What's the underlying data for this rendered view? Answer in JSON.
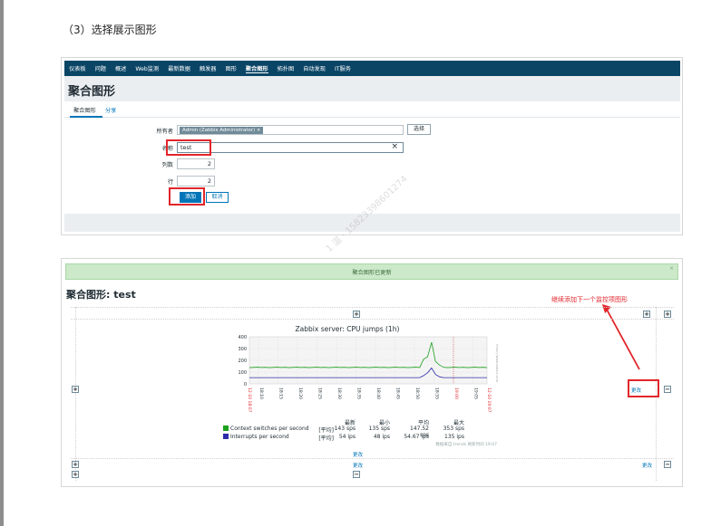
{
  "step_title": "（3）选择展示图形",
  "panel1": {
    "nav": [
      "仪表板",
      "问题",
      "概述",
      "Web监测",
      "最新数据",
      "触发器",
      "图形",
      "聚合图形",
      "拓扑图",
      "自动发现",
      "IT服务"
    ],
    "nav_active": "聚合图形",
    "page_title": "聚合图形",
    "tabs": {
      "main": "聚合图形",
      "share": "分享"
    },
    "form": {
      "owner_label": "所有者",
      "owner_value": "Admin (Zabbix Administrator)",
      "owner_remove": "×",
      "select_label": "选择",
      "name_label": "名称",
      "name_value": "test",
      "name_clear": "×",
      "columns_label": "列数",
      "columns_value": "2",
      "rows_label": "行",
      "rows_value": "2",
      "add_label": "添加",
      "cancel_label": "取消"
    },
    "highlight_color": "#e2252b",
    "nav_color": "#0b4566"
  },
  "panel2": {
    "message": "聚合图形已更新",
    "message_close": "×",
    "page_title": "聚合图形: test",
    "hint": "继续添加下一个监控项图形",
    "change_label": "更改",
    "plus": "+",
    "minus": "−",
    "graph": {
      "title": "Zabbix server: CPU jumps (1h)",
      "y_ticks": [
        "400",
        "300",
        "200",
        "100",
        "0"
      ],
      "x_ticks": [
        "18:10",
        "18:15",
        "18:20",
        "18:25",
        "18:30",
        "18:35",
        "18:40",
        "18:45",
        "18:50",
        "18:55",
        "19:00",
        "19:05"
      ],
      "start_label": "12-10 18:07",
      "end_label": "12-10 19:07",
      "side_note": "https://www.zabbix.com",
      "legend": [
        {
          "name": "Context switches per second",
          "color": "#1ca01c",
          "agg": "[平均]",
          "last": "143 sps",
          "min": "135 sps",
          "avg": "147.52 sps",
          "max": "353 sps"
        },
        {
          "name": "Interrupts per second",
          "color": "#2c2ca8",
          "agg": "[平均]",
          "last": "54 ips",
          "min": "48 ips",
          "avg": "54.67 ips",
          "max": "135 ips"
        }
      ],
      "col_heads": [
        "最新",
        "最小",
        "平均",
        "最大"
      ],
      "footer_note": "数据来自 trends  刷新时间 19:07"
    }
  },
  "watermark": "1 温 · 15823398601274"
}
